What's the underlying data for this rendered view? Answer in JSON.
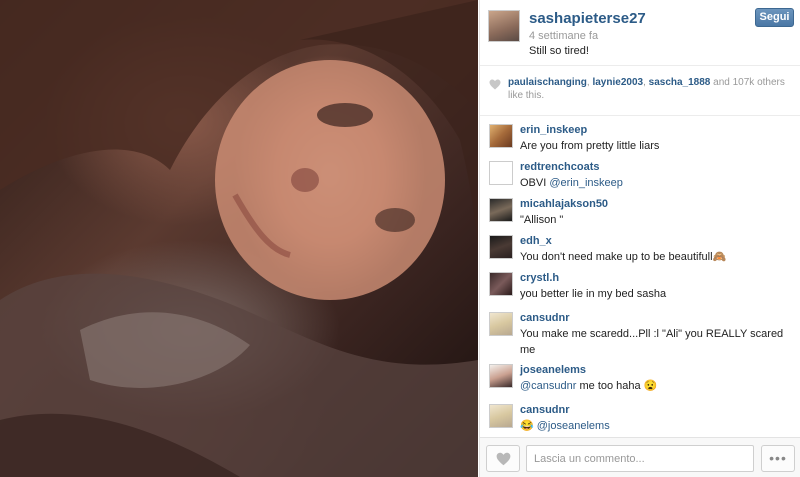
{
  "post": {
    "photo_icon": "photo-selfie",
    "author": "sashapieterse27",
    "time_ago": "4 settimane fa",
    "caption": "Still so tired!",
    "follow_label": "Segui"
  },
  "likes": {
    "users": [
      "paulaischanging",
      "laynie2003",
      "sascha_1888"
    ],
    "sep1": ", ",
    "sep2": ", ",
    "rest": " and 107k others like this."
  },
  "comments": [
    {
      "user": "erin_inskeep",
      "text": "Are you from pretty little liars"
    },
    {
      "user": "redtrenchcoats",
      "mention": "@erin_inskeep",
      "prefix": "OBVI "
    },
    {
      "user": "micahlajakson50",
      "text": "\"Allison \""
    },
    {
      "user": "edh_x",
      "text": "You don't need make up to be beautifull🙈"
    },
    {
      "user": "crystl.h",
      "text": "you better lie in my bed sasha"
    },
    {
      "user": "cansudnr",
      "text": "You make me scaredd...Pll :l \"Ali\" you REALLY scared me"
    },
    {
      "user": "joseanelems",
      "mention": "@cansudnr",
      "suffix": " me too haha 😧"
    },
    {
      "user": "cansudnr",
      "mention": "@joseanelems",
      "prefix": "😂 "
    }
  ],
  "footer": {
    "comment_placeholder": "Lascia un commento...",
    "more_label": "•••"
  }
}
